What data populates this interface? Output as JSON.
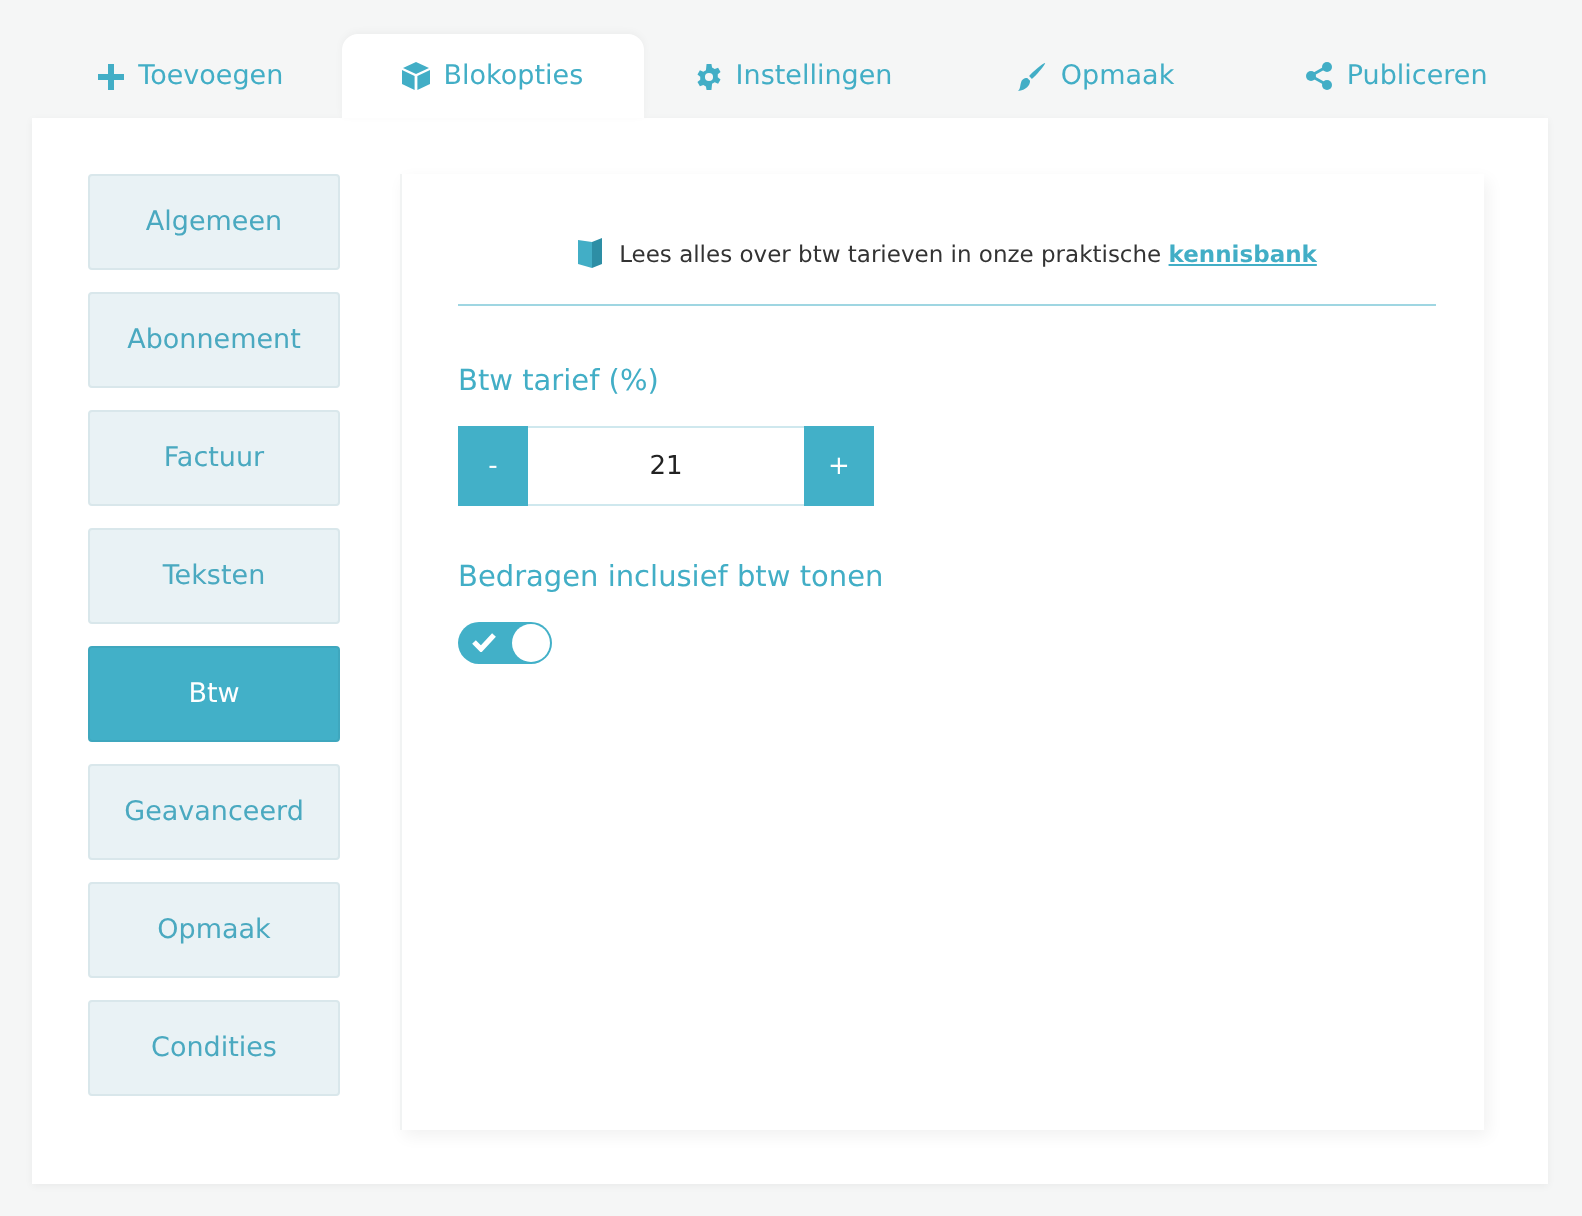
{
  "tabs": [
    {
      "label": "Toevoegen",
      "selected": false
    },
    {
      "label": "Blokopties",
      "selected": true
    },
    {
      "label": "Instellingen",
      "selected": false
    },
    {
      "label": "Opmaak",
      "selected": false
    },
    {
      "label": "Publiceren",
      "selected": false
    }
  ],
  "sidebar": {
    "items": [
      {
        "label": "Algemeen",
        "selected": false
      },
      {
        "label": "Abonnement",
        "selected": false
      },
      {
        "label": "Factuur",
        "selected": false
      },
      {
        "label": "Teksten",
        "selected": false
      },
      {
        "label": "Btw",
        "selected": true
      },
      {
        "label": "Geavanceerd",
        "selected": false
      },
      {
        "label": "Opmaak",
        "selected": false
      },
      {
        "label": "Condities",
        "selected": false
      }
    ]
  },
  "info": {
    "text": "Lees alles over btw tarieven in onze praktische",
    "link": "kennisbank"
  },
  "rate": {
    "label": "Btw tarief (%)",
    "minus": "-",
    "value": "21",
    "plus": "+"
  },
  "inclusive": {
    "label": "Bedragen inclusief btw tonen",
    "on": true
  }
}
